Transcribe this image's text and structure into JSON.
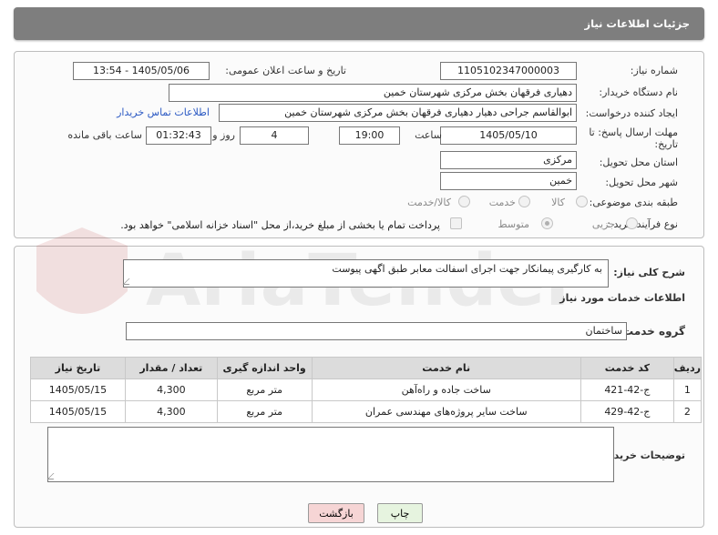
{
  "header": {
    "title": "جزئیات اطلاعات نیاز"
  },
  "form": {
    "need_number": {
      "label": "شماره نیاز:",
      "value": "1105102347000003"
    },
    "announce_datetime": {
      "label": "تاریخ و ساعت اعلان عمومی:",
      "value": "1405/05/06 - 13:54"
    },
    "buyer_org": {
      "label": "نام دستگاه خریدار:",
      "value": "دهیاری فرقهان بخش مرکزی شهرستان خمین"
    },
    "requester": {
      "label": "ایجاد کننده درخواست:",
      "value": "ابوالقاسم جراحی دهیار  دهیاری فرقهان بخش مرکزی شهرستان خمین",
      "contact_link": "اطلاعات تماس خریدار"
    },
    "deadline": {
      "label_line1": "مهلت ارسال پاسخ: تا",
      "label_line2": "تاریخ:",
      "date": "1405/05/10",
      "time_label": "ساعت",
      "time": "19:00",
      "days": "4",
      "days_label": "روز و",
      "remaining": "01:32:43",
      "remaining_label": "ساعت باقی مانده"
    },
    "province": {
      "label": "استان محل تحویل:",
      "value": "مرکزی"
    },
    "city": {
      "label": "شهر محل تحویل:",
      "value": "خمین"
    },
    "category": {
      "label": "طبقه بندی موضوعی:",
      "options": [
        "کالا",
        "خدمت",
        "کالا/خدمت"
      ]
    },
    "purchase_type": {
      "label": "نوع فرآیند خرید :",
      "options": [
        "جزیی",
        "متوسط"
      ],
      "payment_note": "پرداخت تمام یا بخشی از مبلغ خرید،از محل \"اسناد خزانه اسلامی\" خواهد بود."
    }
  },
  "description": {
    "label": "شرح کلی نیاز:",
    "value": "به کارگیری پیمانکار جهت اجرای اسفالت معابر طبق اگهی پیوست"
  },
  "services": {
    "section_title": "اطلاعات خدمات مورد نیاز",
    "group_label": "گروه خدمت:",
    "group_value": "ساختمان",
    "columns": [
      "ردیف",
      "کد خدمت",
      "نام خدمت",
      "واحد اندازه گیری",
      "تعداد / مقدار",
      "تاریخ نیاز"
    ],
    "rows": [
      [
        "1",
        "ج-42-421",
        "ساخت جاده و راه‌آهن",
        "متر مربع",
        "4,300",
        "1405/05/15"
      ],
      [
        "2",
        "ج-42-429",
        "ساخت سایر پروژه‌های مهندسی عمران",
        "متر مربع",
        "4,300",
        "1405/05/15"
      ]
    ]
  },
  "buyer_notes": {
    "label": "توضیحات خریدار:",
    "value": ""
  },
  "buttons": {
    "print": "چاپ",
    "back": "بازگشت"
  },
  "watermark_text": "AriaTender.neT"
}
